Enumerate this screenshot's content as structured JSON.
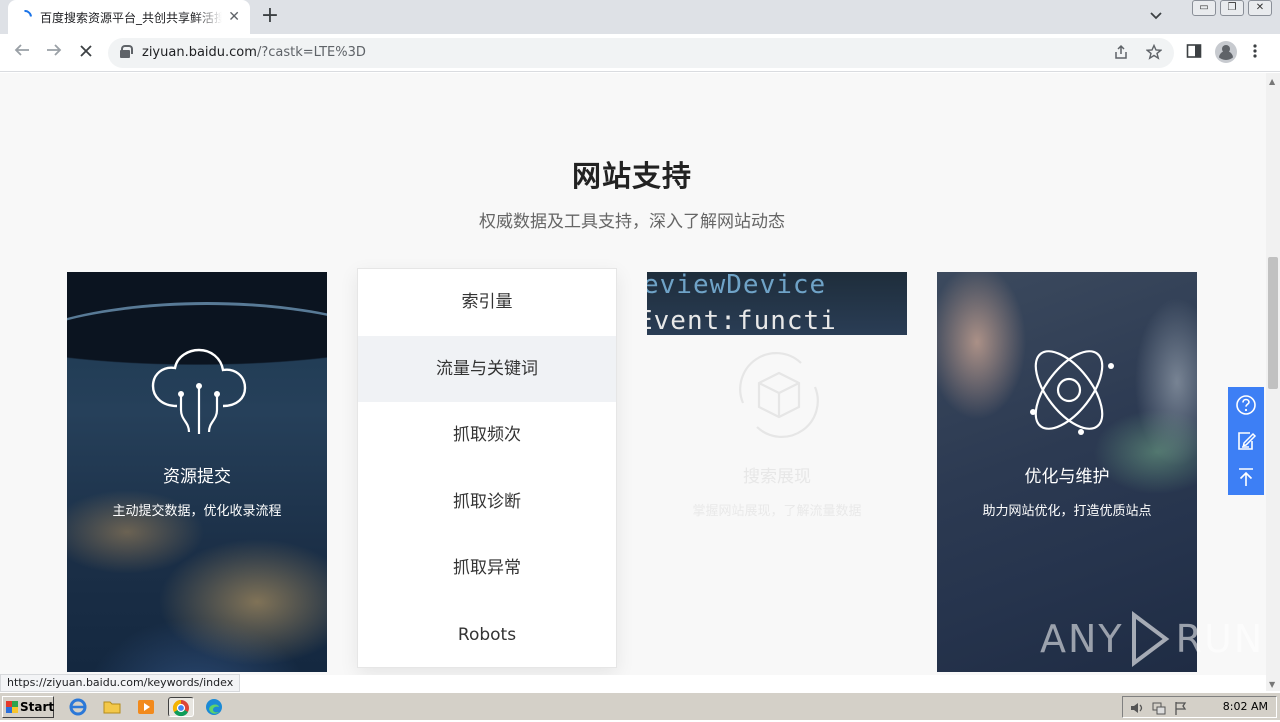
{
  "browser": {
    "tab_title": "百度搜索资源平台_共创共享鲜活搜索",
    "tab_close": "✕",
    "new_tab": "+",
    "url_domain": "ziyuan.baidu.com",
    "url_path": "/?castk=LTE%3D",
    "window_minimize": "▭",
    "window_restore": "❐",
    "window_close": "✕"
  },
  "page": {
    "title": "网站支持",
    "subtitle": "权威数据及工具支持，深入了解网站动态",
    "cards": [
      {
        "title": "资源提交",
        "desc": "主动提交数据，优化收录流程"
      },
      {
        "title": "搜索展现",
        "desc": "掌握网站展现，了解流量数据"
      },
      {
        "title": "优化与维护",
        "desc": "助力网站优化，打造优质站点"
      }
    ],
    "code_text": {
      "line1": "eviewDevice",
      "line2": "Event:functi"
    },
    "menu": [
      {
        "label": "索引量",
        "active": false
      },
      {
        "label": "流量与关键词",
        "active": true
      },
      {
        "label": "抓取频次",
        "active": false
      },
      {
        "label": "抓取诊断",
        "active": false
      },
      {
        "label": "抓取异常",
        "active": false
      },
      {
        "label": "Robots",
        "active": false
      }
    ],
    "float_bar_color": "#3d7ff5"
  },
  "status_url": "https://ziyuan.baidu.com/keywords/index",
  "watermark": {
    "left": "ANY",
    "right": "RUN"
  },
  "taskbar": {
    "start_label": "Start",
    "clock": "8:02 AM"
  }
}
